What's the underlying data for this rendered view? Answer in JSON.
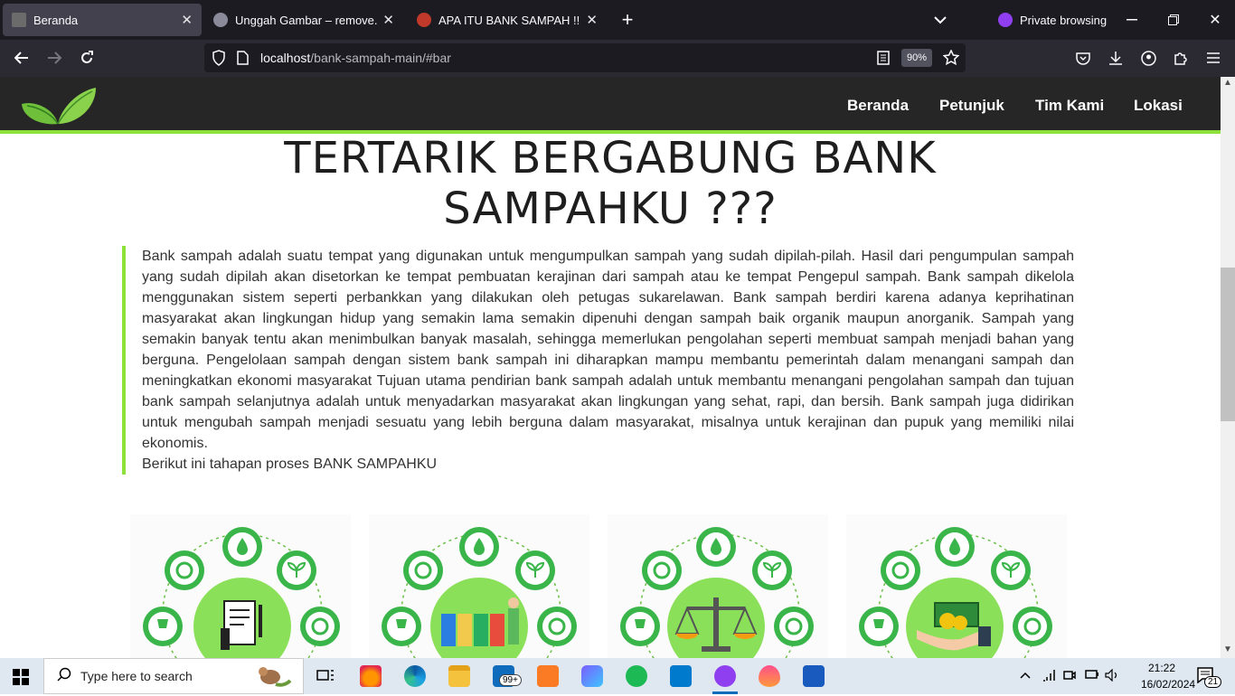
{
  "browser": {
    "tabs": [
      {
        "title": "Beranda",
        "active": true
      },
      {
        "title": "Unggah Gambar – remove.bg",
        "active": false
      },
      {
        "title": "APA ITU BANK SAMPAH !!! | Din",
        "active": false
      }
    ],
    "private_label": "Private browsing",
    "url_host": "localhost",
    "url_path": "/bank-sampah-main/#bar",
    "zoom": "90%"
  },
  "site": {
    "nav": [
      "Beranda",
      "Petunjuk",
      "Tim Kami",
      "Lokasi"
    ],
    "heading_line1": "TERTARIK BERGABUNG BANK",
    "heading_line2": "SAMPAHKU ???",
    "paragraph": "Bank sampah adalah suatu tempat yang digunakan untuk mengumpulkan sampah yang sudah dipilah-pilah. Hasil dari pengumpulan sampah yang sudah dipilah akan disetorkan ke tempat pembuatan kerajinan dari sampah atau ke tempat Pengepul sampah. Bank sampah dikelola menggunakan sistem seperti perbankkan yang dilakukan oleh petugas sukarelawan. Bank sampah berdiri karena adanya keprihatinan masyarakat akan lingkungan hidup yang semakin lama semakin dipenuhi dengan sampah baik organik maupun anorganik. Sampah yang semakin banyak tentu akan menimbulkan banyak masalah, sehingga memerlukan pengolahan seperti membuat sampah menjadi bahan yang berguna. Pengelolaan sampah dengan sistem bank sampah ini diharapkan mampu membantu pemerintah dalam menangani sampah dan meningkatkan ekonomi masyarakat Tujuan utama pendirian bank sampah adalah untuk membantu menangani pengolahan sampah dan tujuan bank sampah selanjutnya adalah untuk menyadarkan masyarakat akan lingkungan yang sehat, rapi, dan bersih. Bank sampah juga didirikan untuk mengubah sampah menjadi sesuatu yang lebih berguna dalam masyarakat, misalnya untuk kerajinan dan pupuk yang memiliki nilai ekonomis.",
    "steps_intro": "Berikut ini tahapan proses BANK SAMPAHKU",
    "step_icons": [
      "document-pen-icon",
      "recycling-bins-icon",
      "balance-scale-icon",
      "money-hand-icon"
    ]
  },
  "taskbar": {
    "search_placeholder": "Type here to search",
    "mail_badge": "99+",
    "time": "21:22",
    "date": "16/02/2024",
    "notif_count": "21"
  },
  "colors": {
    "accent_green": "#8ee03a",
    "site_header": "#262626"
  }
}
